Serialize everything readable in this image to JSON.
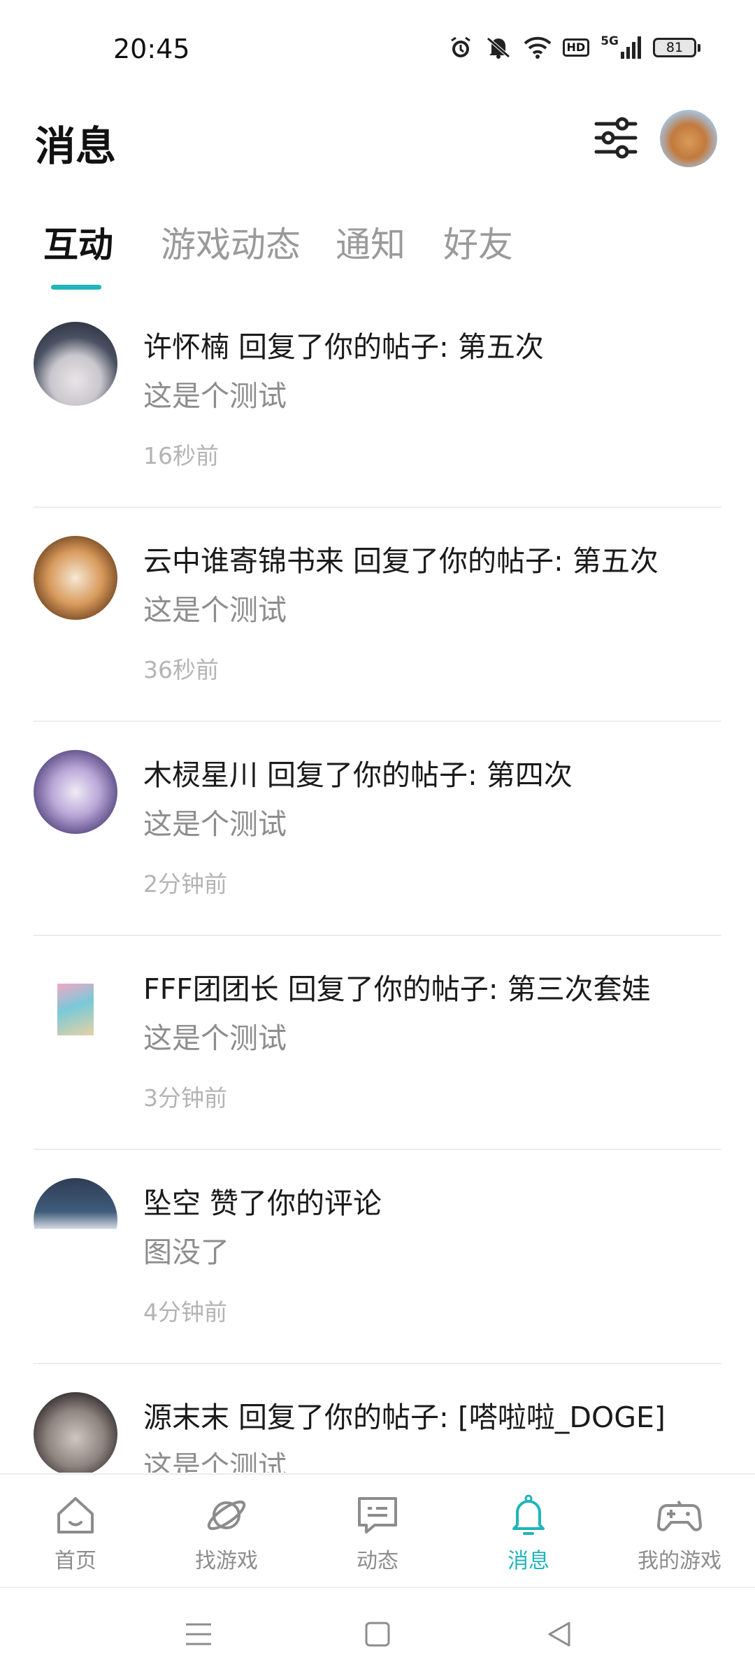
{
  "status_bar": {
    "time": "20:45",
    "icons": [
      "alarm-icon",
      "mute-icon",
      "wifi-icon",
      "hd-icon",
      "5g-signal-icon",
      "battery-icon"
    ],
    "hd_label": "HD",
    "network_label": "5G",
    "battery_level": "81"
  },
  "header": {
    "title": "消息",
    "filter_icon": "filter-sliders-icon",
    "avatar": "user-avatar"
  },
  "tabs": [
    {
      "label": "互动",
      "active": true
    },
    {
      "label": "游戏动态",
      "active": false
    },
    {
      "label": "通知",
      "active": false
    },
    {
      "label": "好友",
      "active": false
    }
  ],
  "messages": [
    {
      "title": "许怀楠 回复了你的帖子: 第五次",
      "body": "这是个测试",
      "time": "16秒前"
    },
    {
      "title": "云中谁寄锦书来 回复了你的帖子: 第五次",
      "body": "这是个测试",
      "time": "36秒前"
    },
    {
      "title": "木棂星川 回复了你的帖子: 第四次",
      "body": "这是个测试",
      "time": "2分钟前"
    },
    {
      "title": "FFF团团长 回复了你的帖子: 第三次套娃",
      "body": "这是个测试",
      "time": "3分钟前"
    },
    {
      "title": "坠空 赞了你的评论",
      "body": "图没了",
      "time": "4分钟前"
    },
    {
      "title": "源末末 回复了你的帖子: [嗒啦啦_DOGE]",
      "body": "这是个测试",
      "time": ""
    }
  ],
  "bottom_nav": [
    {
      "label": "首页",
      "icon": "home-icon",
      "active": false
    },
    {
      "label": "找游戏",
      "icon": "planet-icon",
      "active": false
    },
    {
      "label": "动态",
      "icon": "chat-icon",
      "active": false
    },
    {
      "label": "消息",
      "icon": "bell-icon",
      "active": true
    },
    {
      "label": "我的游戏",
      "icon": "gamepad-icon",
      "active": false
    }
  ],
  "system_nav": [
    "menu-icon",
    "home-square-icon",
    "back-triangle-icon"
  ],
  "colors": {
    "accent": "#1fb5ba",
    "text_primary": "#1a1a1a",
    "text_secondary": "#8d8d8d",
    "text_tertiary": "#b4b4b4"
  }
}
